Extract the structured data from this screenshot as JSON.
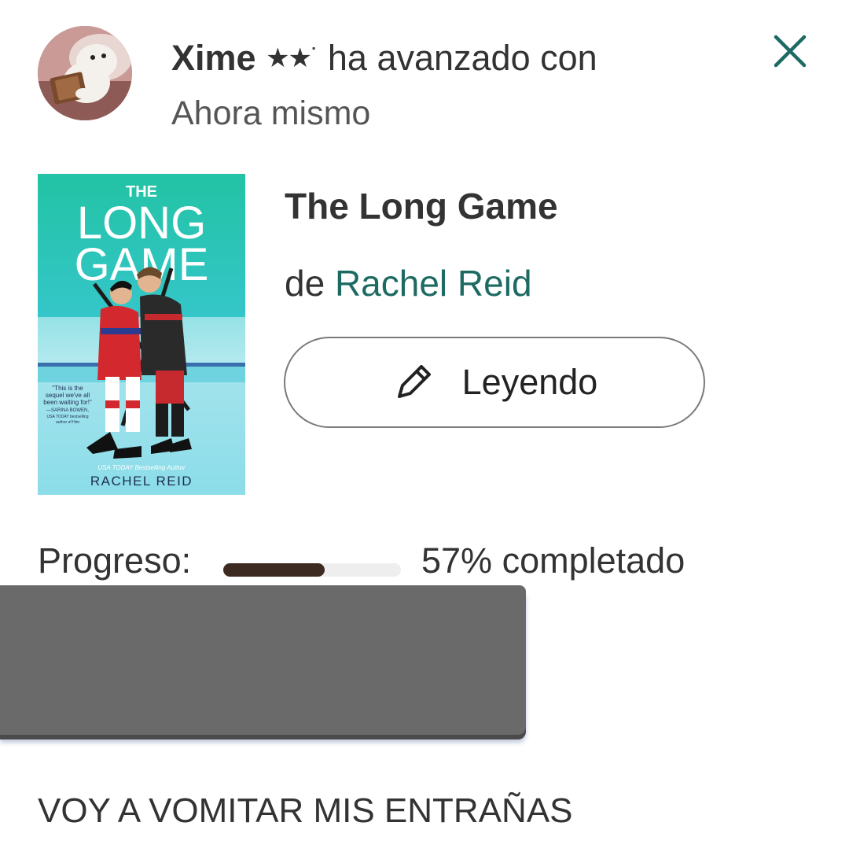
{
  "notification": {
    "username": "Xime",
    "stars": "★★˙",
    "action_text": "ha avanzado con",
    "timestamp": "Ahora mismo",
    "close_icon": "close-icon",
    "avatar_icon": "avatar"
  },
  "book": {
    "title": "The Long Game",
    "by_prefix": "de",
    "author": "Rachel Reid",
    "status_label": "Leyendo",
    "status_icon": "pencil-icon",
    "cover": {
      "title_small": "THE",
      "title_line1": "LONG",
      "title_line2": "GAME",
      "quote_line1": "\"This is the",
      "quote_line2": "sequel we've all",
      "quote_line3": "been waiting for!\"",
      "quote_line4": "—SARINA BOWEN,",
      "quote_line5": "USA TODAY bestselling",
      "quote_line6": "author of Him",
      "tagline": "USA TODAY Bestselling Author",
      "author": "RACHEL REID"
    }
  },
  "progress": {
    "label": "Progreso:",
    "percent": 57,
    "text": "57% completado",
    "fill_color": "#3d2a20",
    "track_color": "#eeeeee"
  },
  "comment": {
    "text": "VOY A VOMITAR MIS ENTRAÑAS"
  },
  "colors": {
    "author_link": "#1d6a63",
    "close_icon": "#1d6a63",
    "cover_teal": "#2bbfa8"
  }
}
